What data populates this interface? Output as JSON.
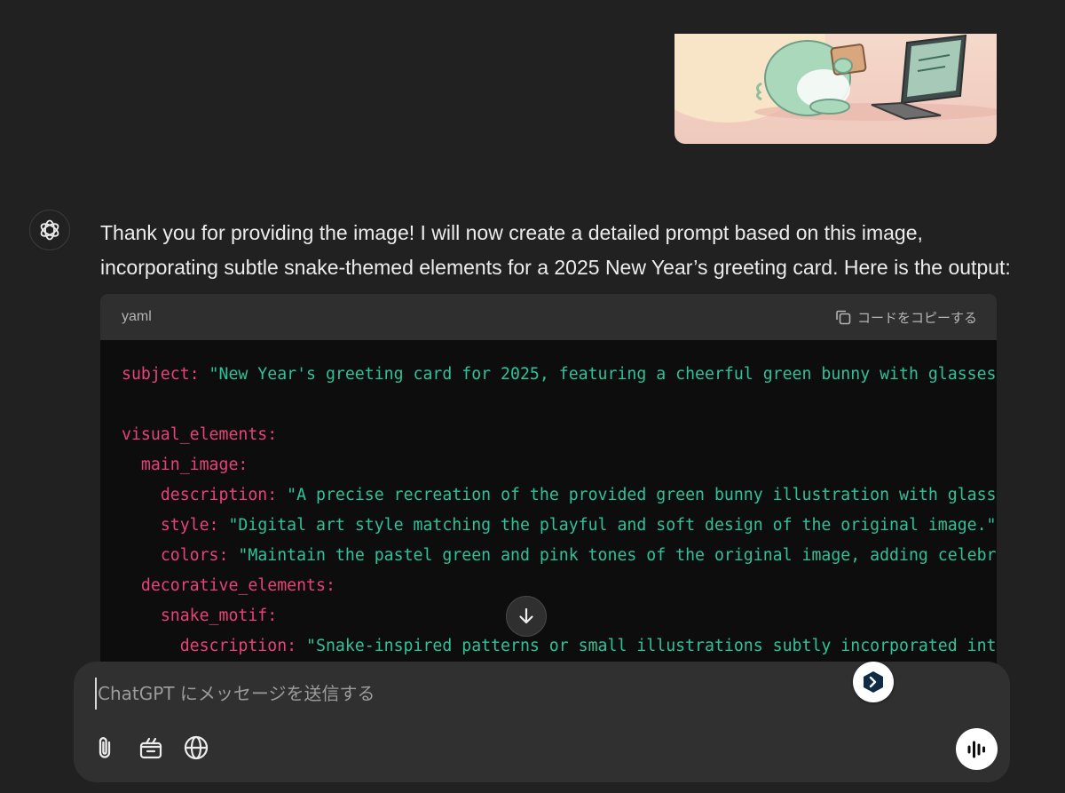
{
  "assistant": {
    "message": "Thank you for providing the image! I will now create a detailed prompt based on this image, incorporating subtle snake-themed elements for a 2025 New Year’s greeting card. Here is the output:"
  },
  "code_block": {
    "language": "yaml",
    "copy_label": "コードをコピーする",
    "lines": [
      {
        "indent": "",
        "key": "subject:",
        "value": " \"New Year's greeting card for 2025, featuring a cheerful green bunny with glasses"
      },
      {
        "indent": "",
        "key": "",
        "value": ""
      },
      {
        "indent": "",
        "key": "visual_elements:",
        "value": ""
      },
      {
        "indent": "  ",
        "key": "main_image:",
        "value": ""
      },
      {
        "indent": "    ",
        "key": "description:",
        "value": " \"A precise recreation of the provided green bunny illustration with glasse"
      },
      {
        "indent": "    ",
        "key": "style:",
        "value": " \"Digital art style matching the playful and soft design of the original image.\""
      },
      {
        "indent": "    ",
        "key": "colors:",
        "value": " \"Maintain the pastel green and pink tones of the original image, adding celebra"
      },
      {
        "indent": "  ",
        "key": "decorative_elements:",
        "value": ""
      },
      {
        "indent": "    ",
        "key": "snake_motif:",
        "value": ""
      },
      {
        "indent": "      ",
        "key": "description:",
        "value": " \"Snake-inspired patterns or small illustrations subtly incorporated into"
      }
    ]
  },
  "composer": {
    "placeholder": "ChatGPT にメッセージを送信する"
  },
  "icons": {
    "attach": "paperclip-icon",
    "tools": "toolbox-icon",
    "web": "globe-icon",
    "voice": "voice-waveform-icon",
    "scroll": "arrow-down-icon",
    "extension": "extension-logo-icon",
    "avatar": "openai-logo-icon"
  },
  "colors": {
    "background": "#212121",
    "code_background": "#0d0d0d",
    "yaml_key": "#e9417a",
    "yaml_string": "#2ec19a"
  }
}
